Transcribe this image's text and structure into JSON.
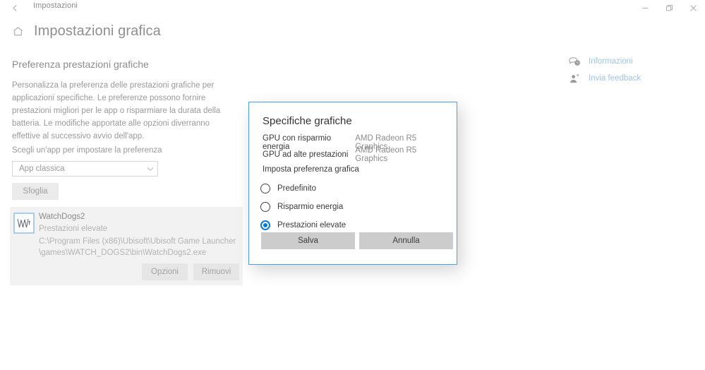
{
  "titlebar": {
    "back_icon": "back-arrow-icon",
    "title": "Impostazioni",
    "minimize_label": "—",
    "restore_label": "❐",
    "close_label": "✕"
  },
  "header": {
    "home_icon": "home-icon",
    "title": "Impostazioni grafica"
  },
  "main": {
    "section_title": "Preferenza prestazioni grafiche",
    "description": "Personalizza la preferenza delle prestazioni grafiche per applicazioni specifiche. Le preferenze possono fornire prestazioni migliori per le app o risparmiare la durata della batteria. Le modifiche apportate alle opzioni diverranno effettive al successivo avvio dell'app.",
    "field_label": "Scegli un'app per impostare la preferenza",
    "combo": {
      "value": "App classica",
      "chevron_icon": "chevron-down-icon"
    },
    "browse_button": "Sfoglia",
    "app_entry": {
      "icon": "watchdogs2-app-icon",
      "name": "WatchDogs2",
      "preference": "Prestazioni elevate",
      "path": "C:\\Program Files (x86)\\Ubisoft\\Ubisoft Game Launcher\\games\\WATCH_DOGS2\\bin\\WatchDogs2.exe",
      "options_button": "Opzioni",
      "remove_button": "Rimuovi"
    }
  },
  "right_panel": {
    "links": [
      {
        "icon": "help-bubble-icon",
        "label": "Informazioni"
      },
      {
        "icon": "feedback-person-icon",
        "label": "Invia feedback"
      }
    ]
  },
  "dialog": {
    "title": "Specifiche grafiche",
    "gpu_rows": [
      {
        "label": "GPU con risparmio energia",
        "value": "AMD Radeon R5 Graphics"
      },
      {
        "label": "GPU ad alte prestazioni",
        "value": "AMD Radeon R5 Graphics"
      }
    ],
    "preference_heading": "Imposta preferenza grafica",
    "options": [
      {
        "label": "Predefinito",
        "selected": false
      },
      {
        "label": "Risparmio energia",
        "selected": false
      },
      {
        "label": "Prestazioni elevate",
        "selected": true
      }
    ],
    "save_button": "Salva",
    "cancel_button": "Annulla"
  },
  "colors": {
    "accent": "#0a7bd4",
    "dialog_border": "#4a9fe0",
    "link": "#9fc3e3",
    "card_bg": "#f2f2f2"
  }
}
